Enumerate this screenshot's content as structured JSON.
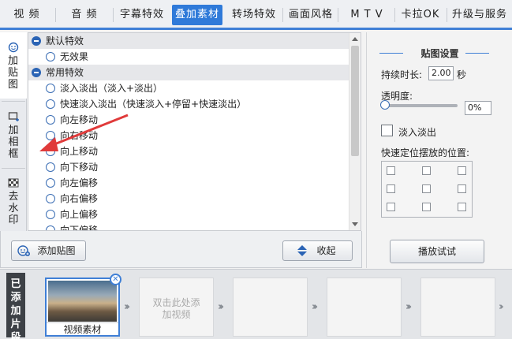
{
  "tabs": [
    {
      "label": "视  频"
    },
    {
      "label": "音  频"
    },
    {
      "label": "字幕特效"
    },
    {
      "label": "叠加素材"
    },
    {
      "label": "转场特效"
    },
    {
      "label": "画面风格"
    },
    {
      "label": "M T V"
    },
    {
      "label": "卡拉OK"
    },
    {
      "label": "升级与服务"
    }
  ],
  "side_tabs": [
    {
      "label": "加贴图"
    },
    {
      "label": "加相框"
    },
    {
      "label": "去水印"
    }
  ],
  "effects": {
    "group_default": "默认特效",
    "item_none": "无效果",
    "group_common": "常用特效",
    "items": [
      "淡入淡出（淡入+淡出）",
      "快速淡入淡出（快速淡入+停留+快速淡出）",
      "向左移动",
      "向右移动",
      "向上移动",
      "向下移动",
      "向左偏移",
      "向右偏移",
      "向上偏移",
      "向下偏移"
    ]
  },
  "list_buttons": {
    "add_sticker": "添加贴图",
    "collapse": "收起"
  },
  "panel": {
    "title": "贴图设置",
    "duration_label": "持续时长:",
    "duration_value": "2.00",
    "duration_unit": "秒",
    "opacity_label": "透明度:",
    "opacity_value": "0%",
    "opacity_level": 0,
    "fade_label": "淡入淡出",
    "position_label": "快速定位摆放的位置:",
    "play_button": "播放试试"
  },
  "strip": {
    "label": "已添加片段",
    "first_clip": "视频素材",
    "add_clip": "双击此处添加视频"
  },
  "colors": {
    "accent": "#2f7ad9",
    "annotation": "#e03a3a"
  }
}
